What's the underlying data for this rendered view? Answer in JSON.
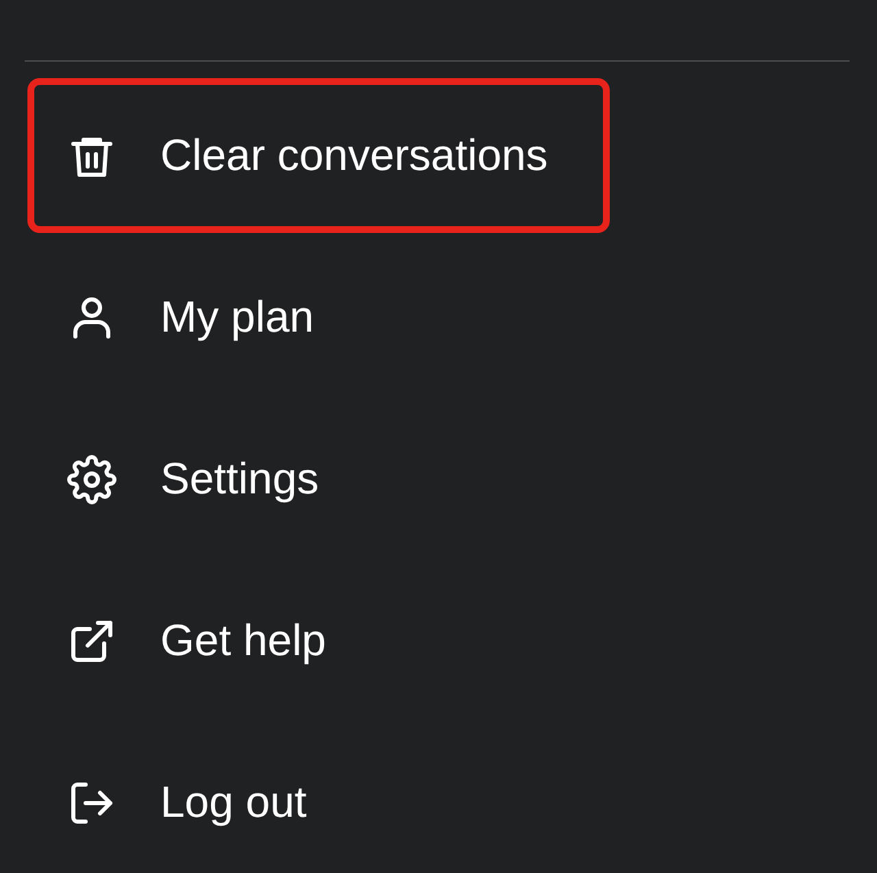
{
  "menu": {
    "items": [
      {
        "kind": "trash",
        "label": "Clear conversations",
        "highlighted": true
      },
      {
        "kind": "user",
        "label": "My plan",
        "highlighted": false
      },
      {
        "kind": "gear",
        "label": "Settings",
        "highlighted": false
      },
      {
        "kind": "external",
        "label": "Get help",
        "highlighted": false
      },
      {
        "kind": "logout",
        "label": "Log out",
        "highlighted": false
      }
    ]
  }
}
